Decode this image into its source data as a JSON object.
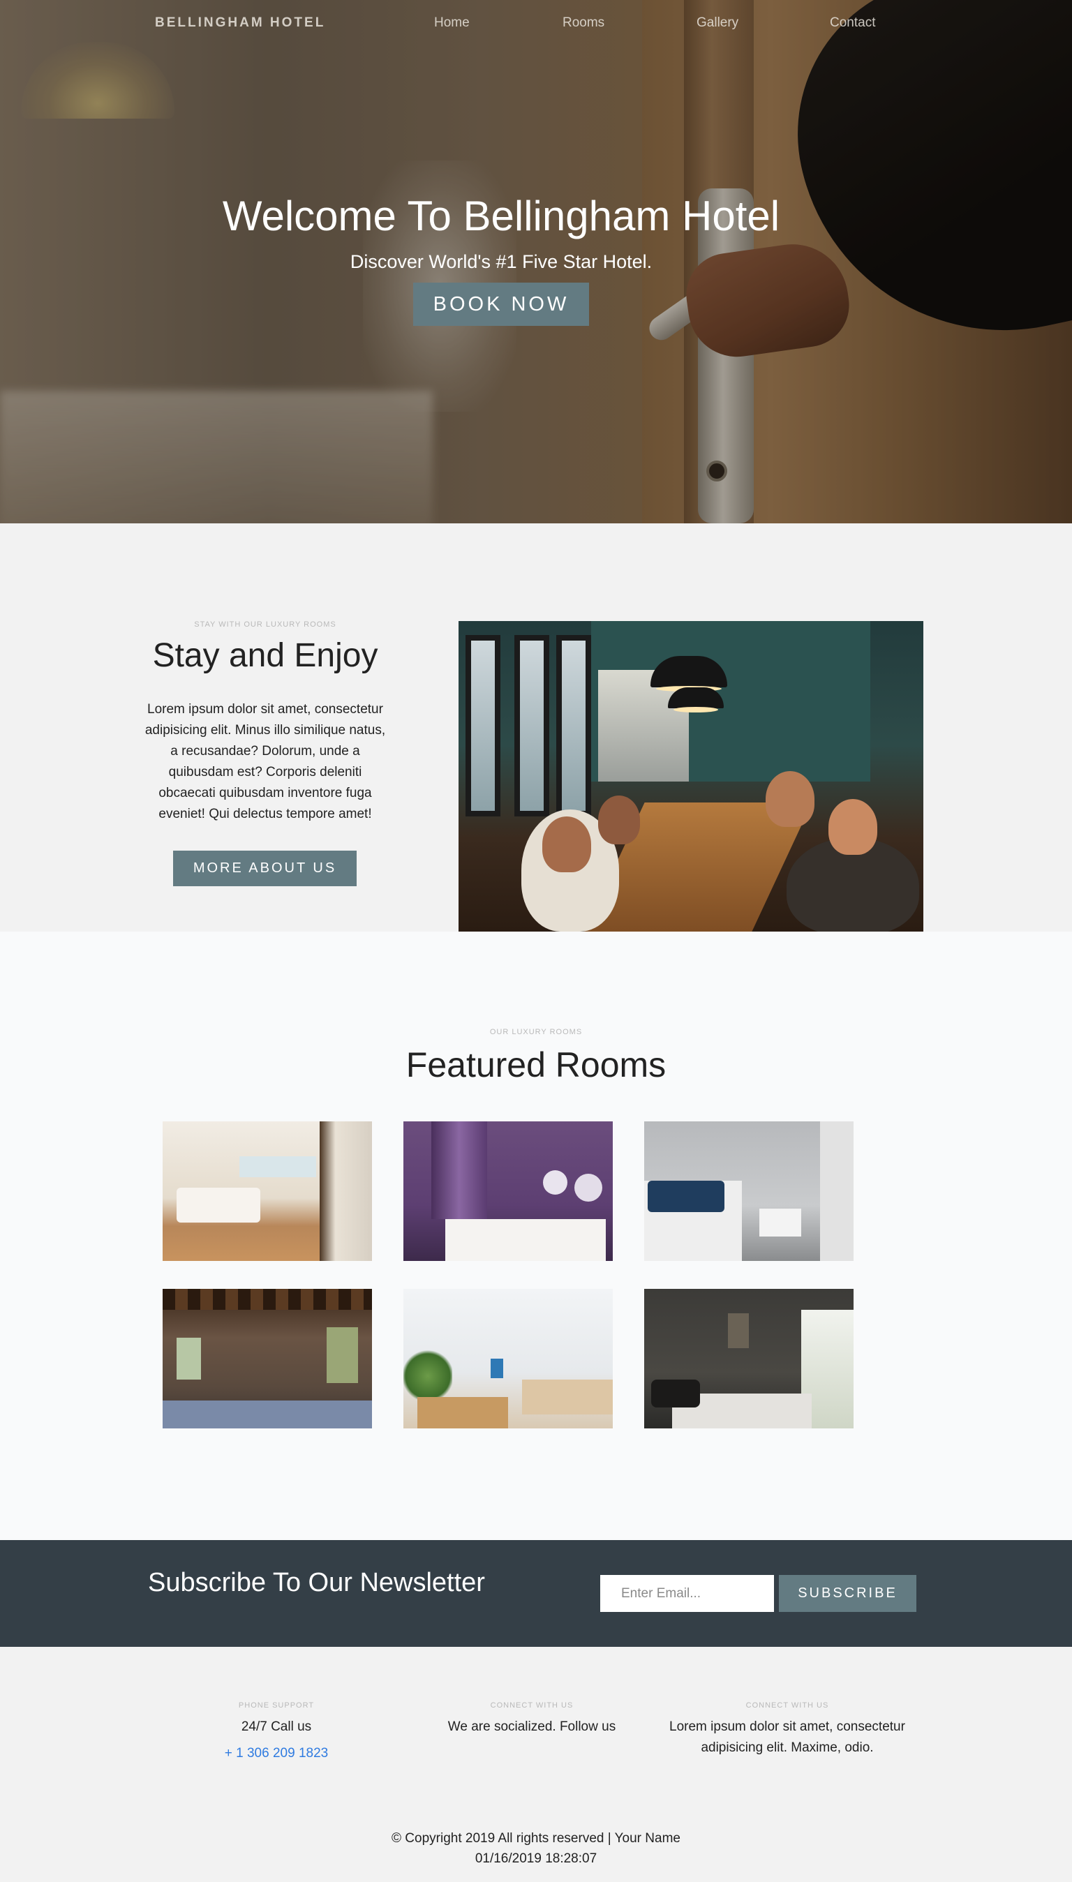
{
  "nav": {
    "brand": "BELLINGHAM HOTEL",
    "links": [
      "Home",
      "Rooms",
      "Gallery",
      "Contact"
    ]
  },
  "hero": {
    "title": "Welcome To Bellingham Hotel",
    "subtitle": "Discover World's #1 Five Star Hotel.",
    "cta": "BOOK NOW"
  },
  "about": {
    "eyebrow": "STAY WITH OUR LUXURY ROOMS",
    "title": "Stay and Enjoy",
    "body": "Lorem ipsum dolor sit amet, consectetur adipisicing elit. Minus illo similique natus, a recusandae? Dolorum, unde a quibusdam est? Corporis deleniti obcaecati quibusdam inventore fuga eveniet! Qui delectus tempore amet!",
    "cta": "MORE ABOUT US"
  },
  "rooms": {
    "eyebrow": "OUR LUXURY ROOMS",
    "title": "Featured Rooms"
  },
  "newsletter": {
    "title": "Subscribe To Our Newsletter",
    "placeholder": "Enter Email...",
    "cta": "SUBSCRIBE"
  },
  "footer": {
    "columns": [
      {
        "eyebrow": "PHONE SUPPORT",
        "text": "24/7 Call us",
        "link": "+ 1 306 209 1823"
      },
      {
        "eyebrow": "CONNECT WITH US",
        "text": "We are socialized. Follow us"
      },
      {
        "eyebrow": "CONNECT WITH US",
        "text": "Lorem ipsum dolor sit amet, consectetur adipisicing elit. Maxime, odio."
      }
    ],
    "copyright": "© Copyright 2019 All rights reserved | Your Name",
    "timestamp": "01/16/2019 18:28:07"
  },
  "colors": {
    "accent": "#637b82",
    "newsletter_bg": "#343f47",
    "link": "#2f7be0"
  }
}
